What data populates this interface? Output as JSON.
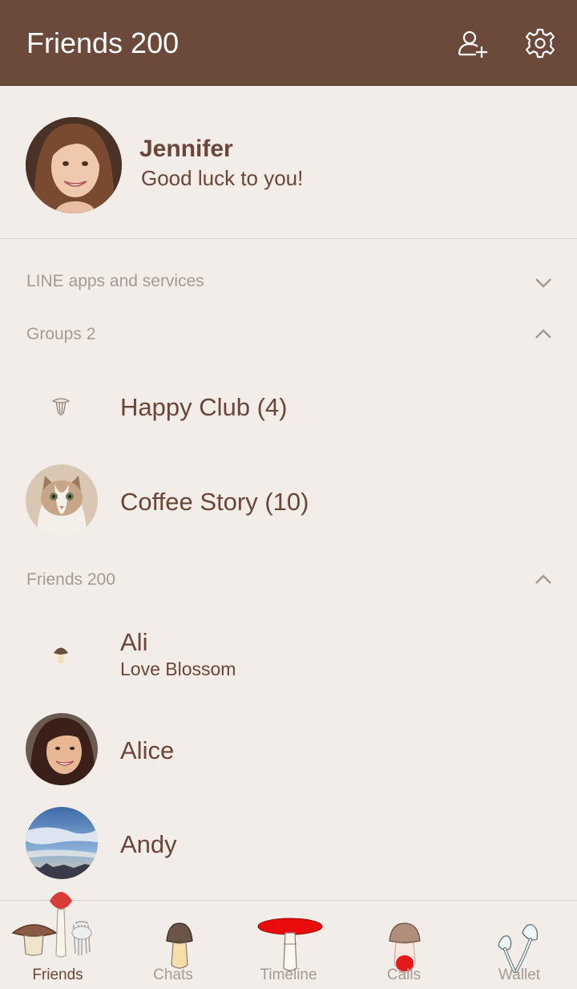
{
  "header": {
    "title": "Friends 200",
    "add_friend_icon": "add-friend-icon",
    "settings_icon": "gear-icon",
    "bg_color": "#6b4a3c"
  },
  "profile": {
    "name": "Jennifer",
    "status": "Good luck to you!"
  },
  "sections": {
    "services": "LINE apps and services",
    "groups": "Groups 2",
    "friends": "Friends 200"
  },
  "groups": [
    {
      "name": "Happy Club (4)"
    },
    {
      "name": "Coffee Story (10)"
    }
  ],
  "friends": [
    {
      "name": "Ali",
      "status": "Love Blossom"
    },
    {
      "name": "Alice"
    },
    {
      "name": "Andy"
    }
  ],
  "tabs": [
    {
      "label": "Friends",
      "active": true
    },
    {
      "label": "Chats"
    },
    {
      "label": "Timeline"
    },
    {
      "label": "Calls"
    },
    {
      "label": "Wallet"
    }
  ],
  "colors": {
    "background": "#f2ede8",
    "text": "#6b4638",
    "muted": "#a59a92"
  }
}
